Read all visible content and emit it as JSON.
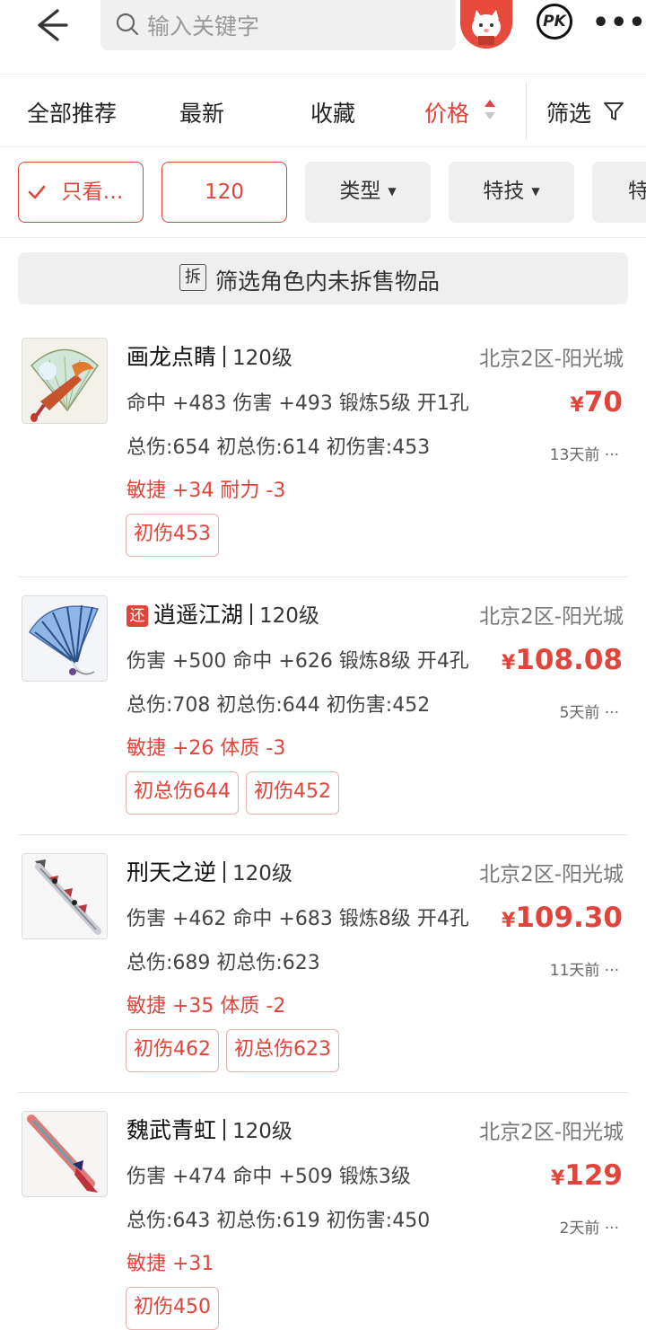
{
  "header": {
    "search_placeholder": "输入关键字",
    "pk_label": "PK",
    "more_label": "•••"
  },
  "sort": {
    "items": [
      "全部推荐",
      "最新",
      "收藏",
      "价格"
    ],
    "active": "价格",
    "filter_label": "筛选"
  },
  "chips": [
    {
      "label": "只看…",
      "style": "outline",
      "checked": true
    },
    {
      "label": "120",
      "style": "outline"
    },
    {
      "label": "类型",
      "style": "gray",
      "dropdown": true
    },
    {
      "label": "特技",
      "style": "gray",
      "dropdown": true
    },
    {
      "label": "特",
      "style": "gray"
    }
  ],
  "notice": {
    "icon_text": "拆",
    "text": "筛选角色内未拆售物品"
  },
  "items": [
    {
      "name": "画龙点睛",
      "level": "120级",
      "server": "北京2区-阳光城",
      "line1": "命中 +483 伤害 +493 锻炼5级 开1孔",
      "line2": "总伤:654 初总伤:614 初伤害:453",
      "line3": "敏捷 +34 耐力 -3",
      "price": "70",
      "time": "13天前 ···",
      "tags": [
        "初伤453"
      ],
      "badge": ""
    },
    {
      "name": "逍遥江湖",
      "level": "120级",
      "server": "北京2区-阳光城",
      "line1": "伤害 +500 命中 +626 锻炼8级 开4孔",
      "line2": "总伤:708 初总伤:644 初伤害:452",
      "line3": "敏捷 +26 体质 -3",
      "price": "108.08",
      "time": "5天前 ···",
      "tags": [
        "初总伤644",
        "初伤452"
      ],
      "badge": "还"
    },
    {
      "name": "刑天之逆",
      "level": "120级",
      "server": "北京2区-阳光城",
      "line1": "伤害 +462 命中 +683 锻炼8级 开4孔",
      "line2": "总伤:689 初总伤:623",
      "line3": "敏捷 +35 体质 -2",
      "price": "109.30",
      "time": "11天前 ···",
      "tags": [
        "初伤462",
        "初总伤623"
      ],
      "badge": ""
    },
    {
      "name": "魏武青虹",
      "level": "120级",
      "server": "北京2区-阳光城",
      "line1": "伤害 +474 命中 +509 锻炼3级",
      "line2": "总伤:643 初总伤:619 初伤害:450",
      "line3": "敏捷 +31",
      "price": "129",
      "time": "2天前 ···",
      "tags": [
        "初伤450"
      ],
      "badge": ""
    }
  ],
  "currency_symbol": "¥",
  "colors": {
    "accent": "#e0443a",
    "chip_gray": "#efefef",
    "divider": "#e8e8e8"
  }
}
